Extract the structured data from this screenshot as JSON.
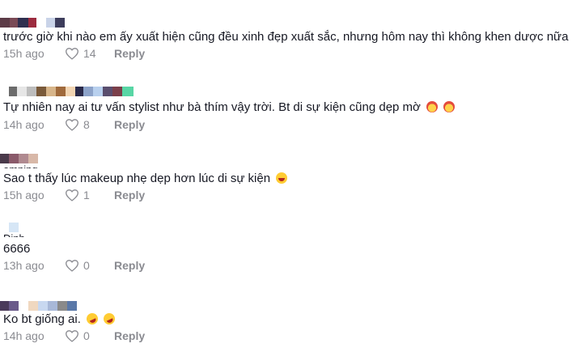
{
  "reply_label": "Reply",
  "comments": [
    {
      "text": "trước giờ khi nào em ấy xuất hiện cũng đều xinh đẹp xuất sắc, nhưng hôm nay thì không khen dược nữa",
      "time": "15h ago",
      "likes": "14"
    },
    {
      "text": "Tự nhiên nay ai tư vấn stylist như bà thím vậy trời. Bt di sự kiện cũng dẹp mờ",
      "time": "14h ago",
      "likes": "8"
    },
    {
      "text": "Sao t thấy lúc makeup nhẹ dẹp hơn lúc di sự kiện",
      "time": "15h ago",
      "likes": "1"
    },
    {
      "text": "6666",
      "time": "13h ago",
      "likes": "0"
    },
    {
      "text": "Ko bt giống ai.",
      "time": "14h ago",
      "likes": "0"
    }
  ],
  "partial_names": [
    "omning",
    "Dinh"
  ],
  "colors": {
    "text": "#161823",
    "meta": "#8a8b91"
  }
}
